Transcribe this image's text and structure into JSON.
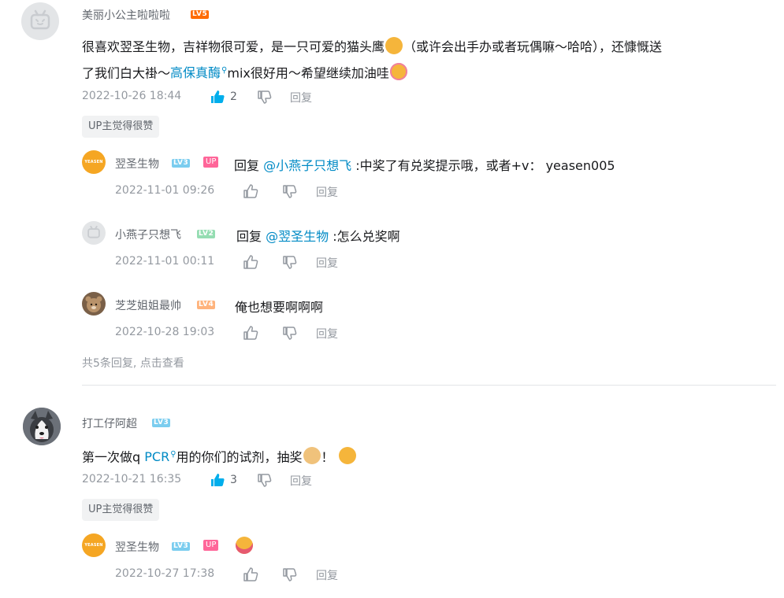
{
  "comments": [
    {
      "user": "美丽小公主啦啦啦",
      "level": "LV5",
      "text_part1": "很喜欢翌圣生物，吉祥物很可爱，是一只可爱的猫头鹰",
      "text_part2": "（或许会出手办或者玩偶嘛～哈哈），还慷慨送",
      "text_part3": "了我们白大褂～",
      "link": "高保真酶",
      "text_part4": "mix很好用～希望继续加油哇",
      "timestamp": "2022-10-26 18:44",
      "likes": "2",
      "reply_label": "回复",
      "up_tag": "UP主觉得很赞",
      "replies": [
        {
          "user": "翌圣生物",
          "level": "LV3",
          "up": "UP",
          "prefix": "回复",
          "mention": "@小燕子只想飞",
          "text": ":中奖了有兑奖提示哦，或者+v： yeasen005",
          "timestamp": "2022-11-01 09:26",
          "reply_label": "回复",
          "avatar_text": "YEASEN"
        },
        {
          "user": "小燕子只想飞",
          "level": "LV2",
          "prefix": "回复",
          "mention": "@翌圣生物",
          "text": ":怎么兑奖啊",
          "timestamp": "2022-11-01 00:11",
          "reply_label": "回复"
        },
        {
          "user": "芝芝姐姐最帅",
          "level": "LV4",
          "text": "俺也想要啊啊啊",
          "timestamp": "2022-10-28 19:03",
          "reply_label": "回复"
        }
      ],
      "view_more": "共5条回复, 点击查看"
    },
    {
      "user": "打工仔阿超",
      "level": "LV3",
      "text_part1": "第一次做q",
      "link": "PCR",
      "text_part2": "用的你们的试剂，抽奖",
      "text_part3": "！",
      "timestamp": "2022-10-21 16:35",
      "likes": "3",
      "reply_label": "回复",
      "up_tag": "UP主觉得很赞",
      "replies": [
        {
          "user": "翌圣生物",
          "level": "LV3",
          "up": "UP",
          "timestamp": "2022-10-27 17:38",
          "reply_label": "回复",
          "avatar_text": "YEASEN"
        }
      ]
    }
  ],
  "colors": {
    "link": "#008ac5",
    "like_active": "#00aeec",
    "up_badge": "#ff6699",
    "yeasen": "#f5a623"
  }
}
